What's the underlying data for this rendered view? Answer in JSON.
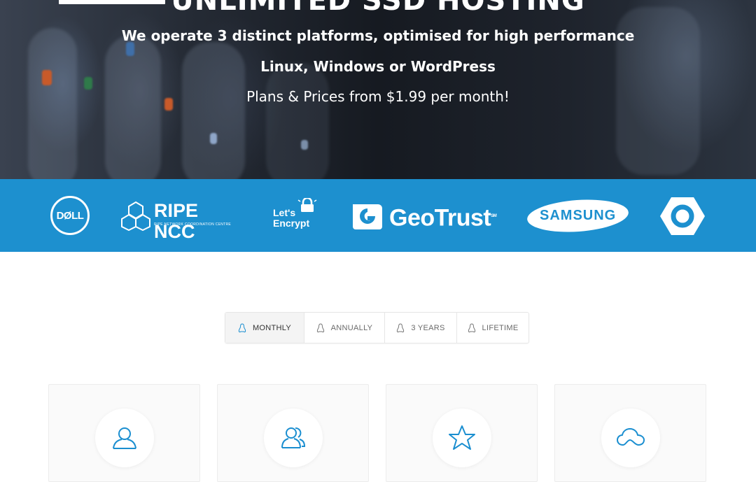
{
  "hero": {
    "title": "UNLIMITED SSD HOSTING",
    "line1": "We operate 3 distinct platforms, optimised for high performance",
    "line2": "Linux, Windows or WordPress",
    "line3": "Plans & Prices from $1.99 per month!"
  },
  "partners": {
    "dell": "DØLL",
    "ripe_name": "RIPE NCC",
    "ripe_sub": "RIPE NETWORK COORDINATION CENTRE",
    "letsencrypt_1": "Let's",
    "letsencrypt_2": "Encrypt",
    "geotrust": "GeoTrust",
    "geotrust_mark": "SM",
    "samsung": "SAMSUNG"
  },
  "tabs": [
    {
      "label": "MONTHLY",
      "active": true,
      "icon": "linux-icon"
    },
    {
      "label": "ANNUALLY",
      "active": false,
      "icon": "linux-icon"
    },
    {
      "label": "3 YEARS",
      "active": false,
      "icon": "linux-icon"
    },
    {
      "label": "LIFETIME",
      "active": false,
      "icon": "linux-icon"
    }
  ],
  "plans": [
    {
      "icon": "user-icon"
    },
    {
      "icon": "users-icon"
    },
    {
      "icon": "star-icon"
    },
    {
      "icon": "cloud-icon"
    }
  ],
  "colors": {
    "brand_blue": "#1d90cf",
    "icon_blue": "#1a8ed0"
  }
}
